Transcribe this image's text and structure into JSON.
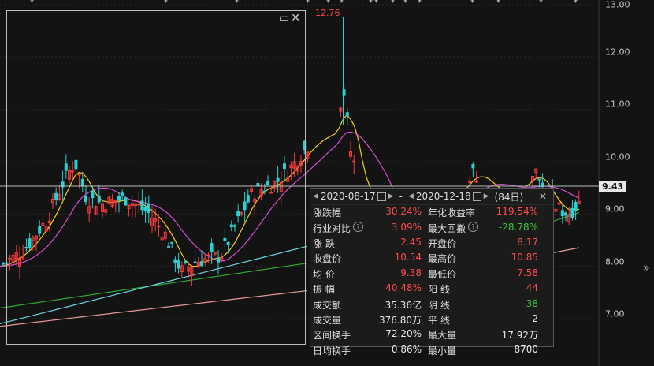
{
  "price_axis": {
    "ticks": [
      "13.00",
      "12.00",
      "11.00",
      "10.00",
      "9.00",
      "8.00",
      "7.00"
    ],
    "current_price": "9.43",
    "high_marker": "12.76"
  },
  "event_marker": "*",
  "selection_icons": {
    "restore": "restore-icon",
    "close": "close-icon"
  },
  "stats_panel": {
    "start_date": "2020-08-17",
    "separator": "-",
    "end_date": "2020-12-18",
    "days": "(84日)",
    "rows": [
      {
        "l_label": "涨跌幅",
        "l_value": "30.24%",
        "l_color": "red",
        "r_label": "年化收益率",
        "r_value": "119.54%",
        "r_color": "red"
      },
      {
        "l_label": "行业对比",
        "l_value": "3.09%",
        "l_color": "red",
        "l_help": true,
        "r_label": "最大回撤",
        "r_value": "-28.78%",
        "r_color": "green",
        "r_help": true
      },
      {
        "l_label": "涨 跌",
        "l_value": "2.45",
        "l_color": "red",
        "r_label": "开盘价",
        "r_value": "8.17",
        "r_color": "red"
      },
      {
        "l_label": "收盘价",
        "l_value": "10.54",
        "l_color": "red",
        "r_label": "最高价",
        "r_value": "10.85",
        "r_color": "red"
      },
      {
        "l_label": "均 价",
        "l_value": "9.38",
        "l_color": "red",
        "r_label": "最低价",
        "r_value": "7.58",
        "r_color": "red"
      },
      {
        "l_label": "振 幅",
        "l_value": "40.48%",
        "l_color": "red",
        "r_label": "阳 线",
        "r_value": "44",
        "r_color": "red"
      },
      {
        "l_label": "成交额",
        "l_value": "35.36亿",
        "l_color": "white",
        "r_label": "阴 线",
        "r_value": "38",
        "r_color": "green"
      },
      {
        "l_label": "成交量",
        "l_value": "376.80万",
        "l_color": "white",
        "r_label": "平 线",
        "r_value": "2",
        "r_color": "white"
      },
      {
        "l_label": "区间换手",
        "l_value": "72.20%",
        "l_color": "white",
        "r_label": "最大量",
        "r_value": "17.92万",
        "r_color": "white"
      },
      {
        "l_label": "日均换手",
        "l_value": "0.86%",
        "l_color": "white",
        "r_label": "最小量",
        "r_value": "8700",
        "r_color": "white"
      }
    ]
  },
  "colors": {
    "up": "#ff3b3b",
    "down": "#2bd0d0",
    "ma5": "#ffffff",
    "ma10": "#f5d21d",
    "ma20": "#d34bd3",
    "ma60": "#2ea82e",
    "ma120": "#6fd3e8",
    "ma250": "#e89a9a"
  }
}
